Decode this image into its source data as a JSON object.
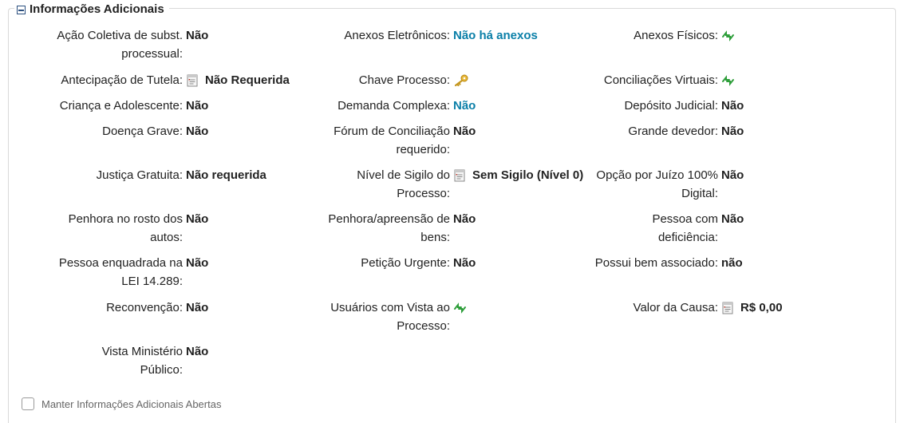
{
  "section": {
    "title": "Informações Adicionais"
  },
  "rows": [
    [
      {
        "label": [
          "Ação Coletiva de subst.",
          "processual:"
        ],
        "value": "Não"
      },
      {
        "label": [
          "Anexos Eletrônicos:"
        ],
        "value": "Não há anexos",
        "link": true
      },
      {
        "label": [
          "Anexos Físicos:"
        ],
        "value": "",
        "icon": "refresh-icon"
      }
    ],
    [
      {
        "label": [
          "Antecipação de Tutela:"
        ],
        "value": "Não Requerida",
        "icon": "document-icon"
      },
      {
        "label": [
          "Chave Processo:"
        ],
        "value": "",
        "icon": "key-icon"
      },
      {
        "label": [
          "Conciliações Virtuais:"
        ],
        "value": "",
        "icon": "refresh-icon"
      }
    ],
    [
      {
        "label": [
          "Criança e Adolescente:"
        ],
        "value": "Não"
      },
      {
        "label": [
          "Demanda Complexa:"
        ],
        "value": "Não",
        "link": true
      },
      {
        "label": [
          "Depósito Judicial:"
        ],
        "value": "Não"
      }
    ],
    [
      {
        "label": [
          "Doença Grave:"
        ],
        "value": "Não"
      },
      {
        "label": [
          "Fórum de Conciliação",
          "requerido:"
        ],
        "value": "Não"
      },
      {
        "label": [
          "Grande devedor:"
        ],
        "value": "Não"
      }
    ],
    [
      {
        "label": [
          "Justiça Gratuita:"
        ],
        "value": "Não requerida"
      },
      {
        "label": [
          "Nível de Sigilo do",
          "Processo:"
        ],
        "value": "Sem Sigilo (Nível 0)",
        "icon": "document-icon"
      },
      {
        "label": [
          "Opção por Juízo 100%",
          "Digital:"
        ],
        "value": "Não"
      }
    ],
    [
      {
        "label": [
          "Penhora no rosto dos",
          "autos:"
        ],
        "value": "Não"
      },
      {
        "label": [
          "Penhora/apreensão de",
          "bens:"
        ],
        "value": "Não"
      },
      {
        "label": [
          "Pessoa com",
          "deficiência:"
        ],
        "value": "Não"
      }
    ],
    [
      {
        "label": [
          "Pessoa enquadrada na",
          "LEI 14.289:"
        ],
        "value": "Não"
      },
      {
        "label": [
          "Petição Urgente:"
        ],
        "value": "Não"
      },
      {
        "label": [
          "Possui bem associado:"
        ],
        "value": "não"
      }
    ],
    [
      {
        "label": [
          "Reconvenção:"
        ],
        "value": "Não"
      },
      {
        "label": [
          "Usuários com Vista ao",
          "Processo:"
        ],
        "value": "",
        "icon": "refresh-icon"
      },
      {
        "label": [
          "Valor da Causa:"
        ],
        "value": "R$ 0,00",
        "icon": "document-icon"
      }
    ],
    [
      {
        "label": [
          "Vista Ministério",
          "Público:"
        ],
        "value": "Não"
      }
    ]
  ],
  "keep_open": {
    "label": "Manter Informações Adicionais Abertas",
    "checked": false
  },
  "colors": {
    "link": "#0a7fa8",
    "icon_green": "#2e9e3a",
    "key_gold": "#d9a520"
  }
}
